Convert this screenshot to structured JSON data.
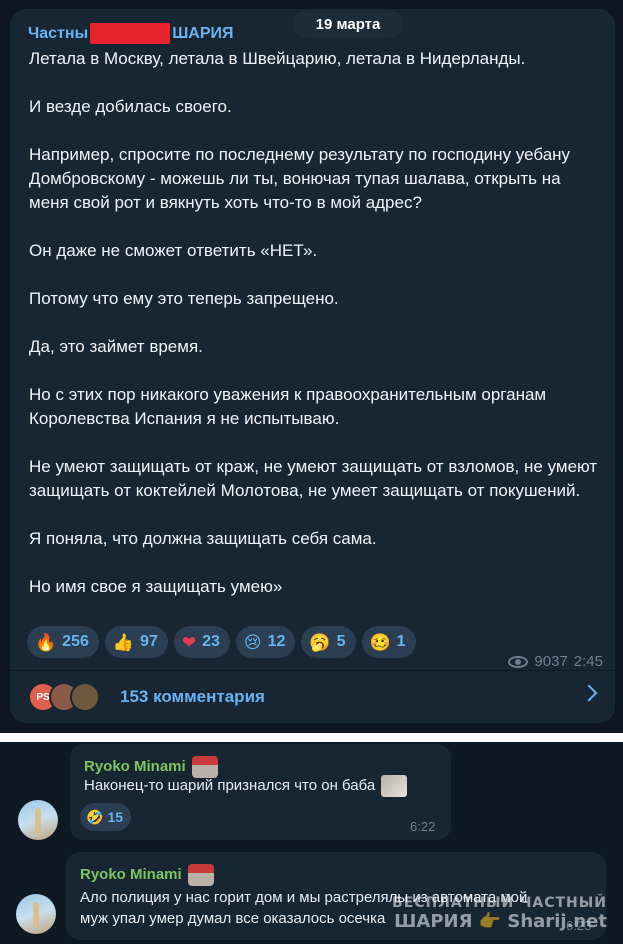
{
  "date_pill": "19 марта",
  "post": {
    "channel_prefix": "Частны",
    "channel_suffix": "ШАРИЯ",
    "paragraphs": [
      "Летала в Москву, летала в Швейцарию, летала в Нидерланды.",
      "И везде добилась своего.",
      "Например, спросите по последнему результату по господину уебану Домбровскому - можешь ли ты, вонючая тупая шалава, открыть на меня свой рот и вякнуть хоть что-то в мой адрес?",
      "Он даже не сможет ответить «НЕТ».",
      "Потому что ему это теперь запрещено.",
      "Да, это займет время.",
      "Но с этих пор никакого уважения к правоохранительным органам Королевства Испания я не испытываю.",
      "Не умеют защищать от краж, не умеют защищать от взломов, не умеют защищать от коктейлей Молотова, не умеет защищать от покушений.",
      "Я поняла, что должна защищать себя сама.",
      "Но имя свое я защищать умею»"
    ],
    "reactions": [
      {
        "emoji": "🔥",
        "count": "256"
      },
      {
        "emoji": "👍",
        "count": "97"
      },
      {
        "emoji": "❤",
        "count": "23"
      },
      {
        "emoji": "😢",
        "count": "12"
      },
      {
        "emoji": "🥱",
        "count": "5"
      },
      {
        "emoji": "🥴",
        "count": "1"
      }
    ],
    "views": "9037",
    "time": "2:45",
    "comments_avatar_initials": "PS",
    "comments_label": "153 комментария"
  },
  "comments": [
    {
      "author": "Ryoko Minami",
      "text": "Наконец-то шарий признался что он баба",
      "reaction_emoji": "🤣",
      "reaction_count": "15",
      "time": "6:22"
    },
    {
      "author": "Ryoko Minami",
      "text_line1": "Ало полиция у нас горит дом и мы растрелялы из автомата мой",
      "text_line2": "муж упал умер думал все оказалось осечка",
      "time": "6:23"
    }
  ],
  "watermark": {
    "line1": "БЕСПЛАТНЫЙ ЧАСТНЫЙ",
    "line2": "ШАРИЯ 👉 Sharij.net"
  }
}
